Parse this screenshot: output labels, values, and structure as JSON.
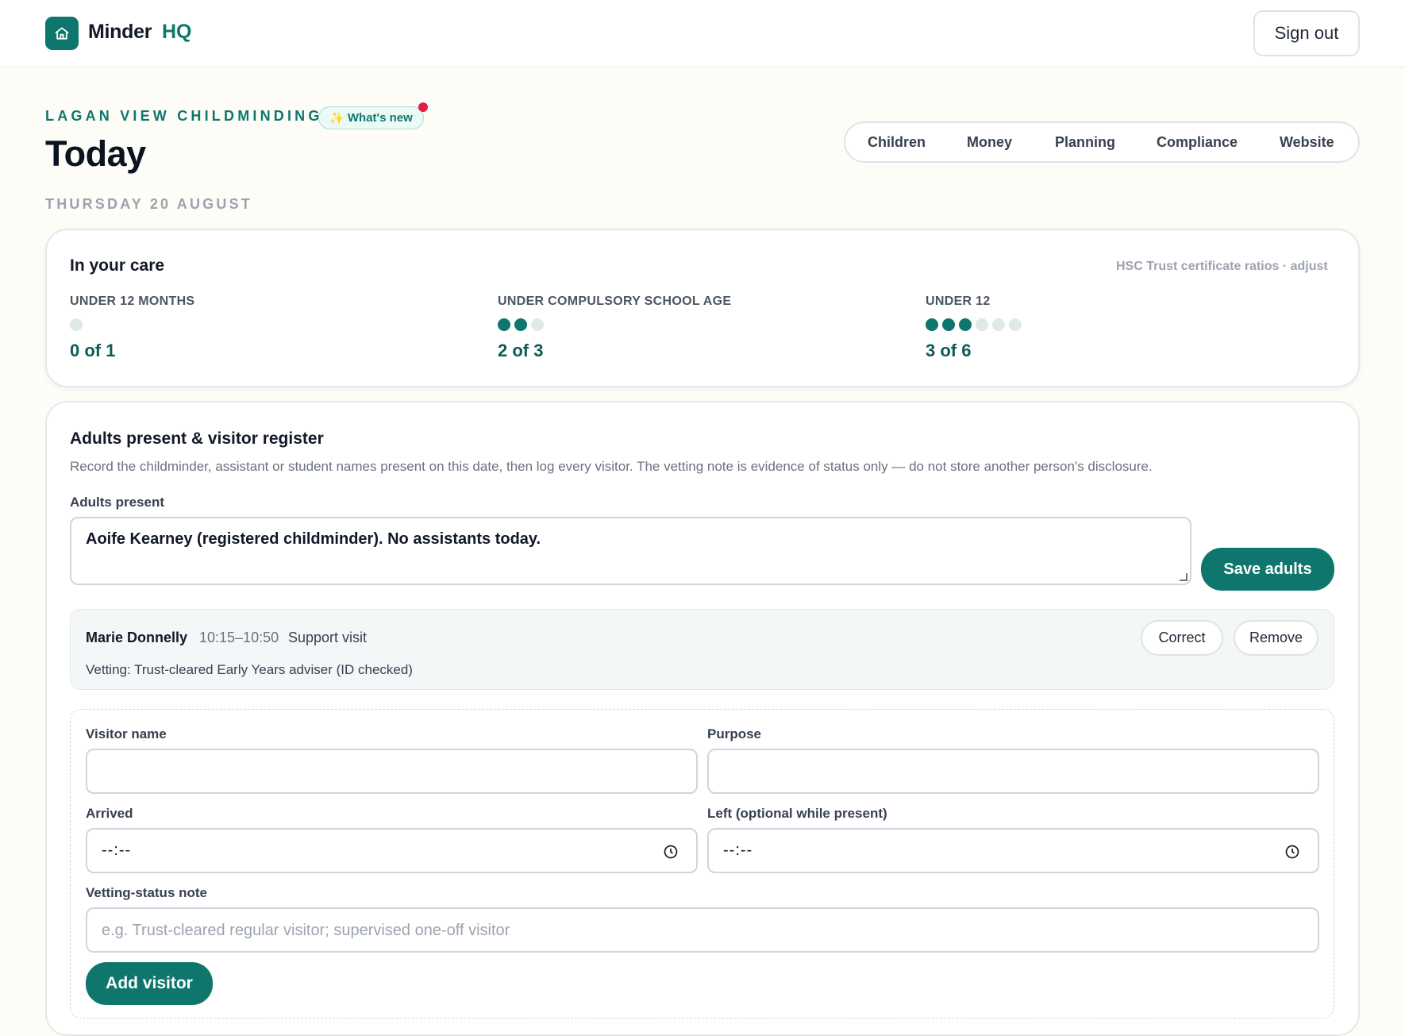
{
  "header": {
    "brand": "Minder",
    "brand_suffix": "HQ",
    "sign_out": "Sign out"
  },
  "page": {
    "org_name": "LAGAN VIEW CHILDMINDING",
    "whats_new": "What's new",
    "title": "Today",
    "date": "THURSDAY 20 AUGUST"
  },
  "nav": {
    "tabs": [
      "Children",
      "Money",
      "Planning",
      "Compliance",
      "Website"
    ]
  },
  "care": {
    "title": "In your care",
    "note": "HSC Trust certificate ratios · adjust",
    "groups": [
      {
        "label": "UNDER 12 MONTHS",
        "count_text": "0 of 1",
        "filled": 0,
        "total": 1
      },
      {
        "label": "UNDER COMPULSORY SCHOOL AGE",
        "count_text": "2 of 3",
        "filled": 2,
        "total": 3
      },
      {
        "label": "UNDER 12",
        "count_text": "3 of 6",
        "filled": 3,
        "total": 6
      }
    ]
  },
  "register": {
    "title": "Adults present & visitor register",
    "description": "Record the childminder, assistant or student names present on this date, then log every visitor. The vetting note is evidence of status only — do not store another person's disclosure.",
    "adults_label": "Adults present",
    "adults_value": "Aoife Kearney (registered childminder). No assistants today.",
    "save_adults": "Save adults",
    "visitors": [
      {
        "name": "Marie Donnelly",
        "time": "10:15–10:50",
        "purpose": "Support visit",
        "vetting": "Vetting: Trust-cleared Early Years adviser (ID checked)",
        "correct_label": "Correct",
        "remove_label": "Remove"
      }
    ],
    "form": {
      "visitor_name_label": "Visitor name",
      "visitor_name_value": "",
      "purpose_label": "Purpose",
      "purpose_value": "",
      "arrived_label": "Arrived",
      "arrived_value": "--:--",
      "left_label": "Left (optional while present)",
      "left_value": "--:--",
      "vetting_label": "Vetting-status note",
      "vetting_placeholder": "e.g. Trust-cleared regular visitor; supervised one-off visitor",
      "add_visitor": "Add visitor"
    }
  },
  "colors": {
    "accent": "#0f766e",
    "background": "#fdfcf6",
    "notification": "#e11d48"
  },
  "icons": {
    "logo": "home-icon",
    "whats_new": "sparkles-icon",
    "time": "clock-icon"
  }
}
